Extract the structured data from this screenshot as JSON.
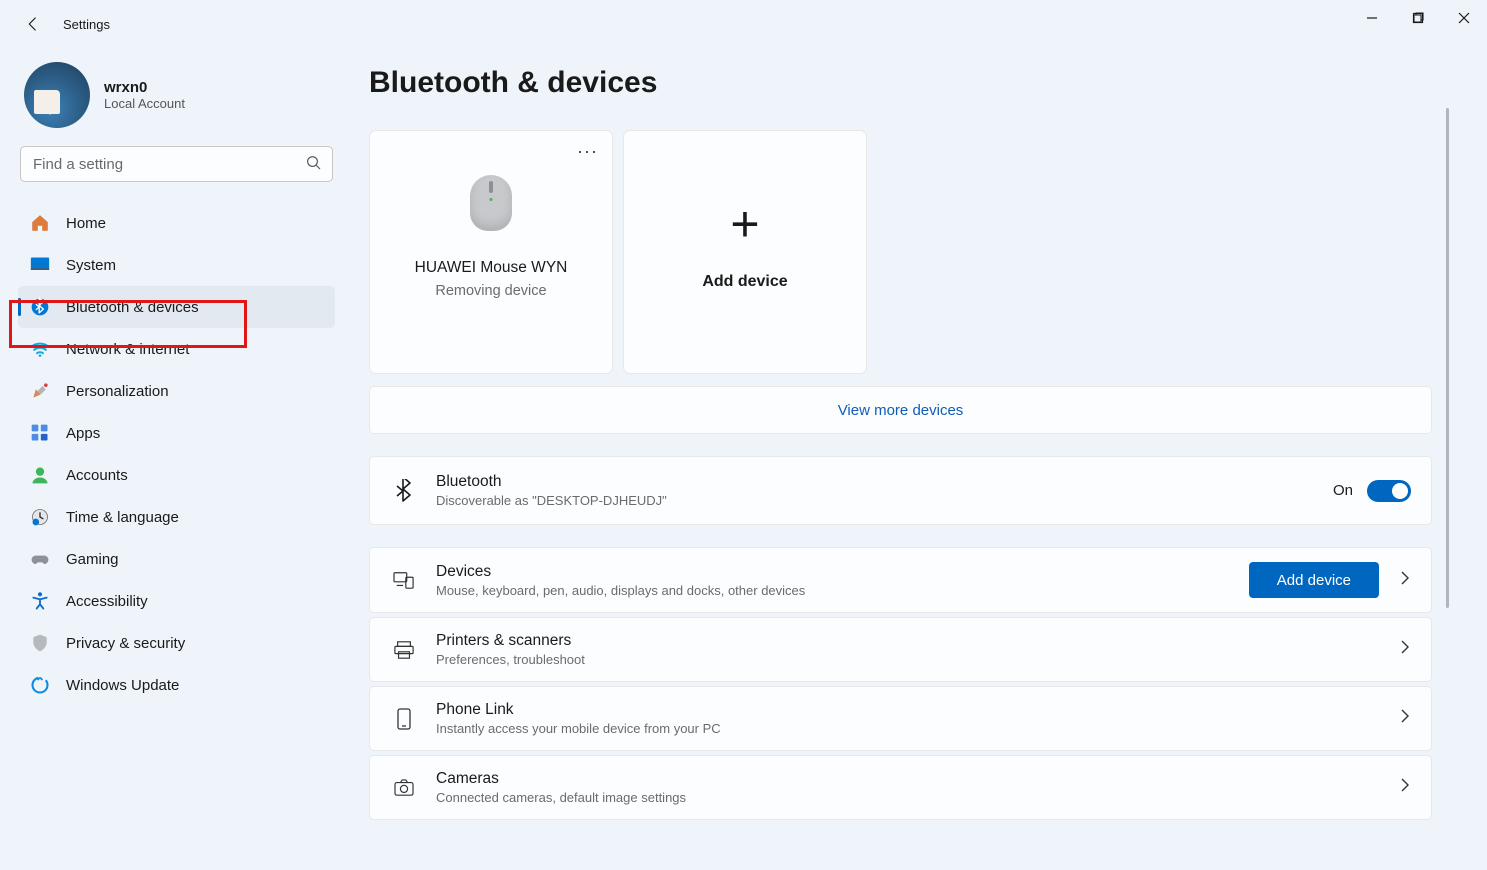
{
  "app_title": "Settings",
  "window_controls": {
    "minimize": "minimize",
    "maximize": "maximize",
    "close": "close"
  },
  "profile": {
    "name": "wrxn0",
    "type": "Local Account"
  },
  "search": {
    "placeholder": "Find a setting"
  },
  "nav": {
    "items": [
      {
        "label": "Home",
        "icon": "home"
      },
      {
        "label": "System",
        "icon": "system"
      },
      {
        "label": "Bluetooth & devices",
        "icon": "bluetooth",
        "selected": true
      },
      {
        "label": "Network & internet",
        "icon": "network"
      },
      {
        "label": "Personalization",
        "icon": "personalization"
      },
      {
        "label": "Apps",
        "icon": "apps"
      },
      {
        "label": "Accounts",
        "icon": "accounts"
      },
      {
        "label": "Time & language",
        "icon": "time"
      },
      {
        "label": "Gaming",
        "icon": "gaming"
      },
      {
        "label": "Accessibility",
        "icon": "accessibility"
      },
      {
        "label": "Privacy & security",
        "icon": "privacy"
      },
      {
        "label": "Windows Update",
        "icon": "update"
      }
    ]
  },
  "page": {
    "title": "Bluetooth & devices",
    "device_card": {
      "name": "HUAWEI Mouse WYN",
      "status": "Removing device"
    },
    "add_device_card": {
      "label": "Add device"
    },
    "view_more": "View more devices",
    "bluetooth": {
      "title": "Bluetooth",
      "subtitle": "Discoverable as \"DESKTOP-DJHEUDJ\"",
      "state_label": "On",
      "state": true
    },
    "rows": [
      {
        "icon": "devices",
        "title": "Devices",
        "subtitle": "Mouse, keyboard, pen, audio, displays and docks, other devices",
        "action_button": "Add device",
        "chevron": true
      },
      {
        "icon": "printers",
        "title": "Printers & scanners",
        "subtitle": "Preferences, troubleshoot",
        "chevron": true
      },
      {
        "icon": "phone",
        "title": "Phone Link",
        "subtitle": "Instantly access your mobile device from your PC",
        "chevron": true
      },
      {
        "icon": "cameras",
        "title": "Cameras",
        "subtitle": "Connected cameras, default image settings",
        "chevron": true
      }
    ]
  },
  "highlight": {
    "target": "nav-item-bluetooth-devices"
  }
}
